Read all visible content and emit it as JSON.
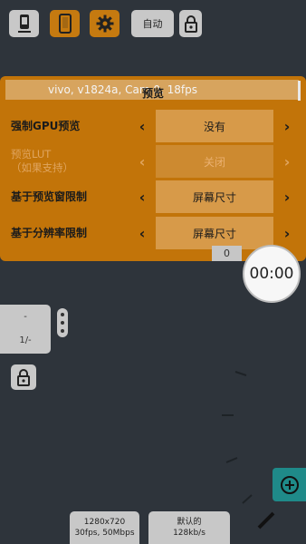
{
  "toolbar": {
    "auto_label": "自动",
    "icons": [
      "phone-preview-icon",
      "phone-icon",
      "gear-icon",
      "lock-icon"
    ]
  },
  "panel": {
    "title": "预览",
    "camera_info": "vivo, v1824a, Cam 0, 18fps",
    "rows": [
      {
        "label": "强制GPU预览",
        "value": "没有",
        "enabled": true
      },
      {
        "label": "预览LUT\n（如果支持）",
        "value": "关闭",
        "enabled": false
      },
      {
        "label": "基于预览窗限制",
        "value": "屏幕尺寸",
        "enabled": true
      },
      {
        "label": "基于分辨率限制",
        "value": "屏幕尺寸",
        "enabled": true
      }
    ],
    "arrow_left": "‹",
    "arrow_right": "›"
  },
  "zoom_value": "0",
  "timer": "00:00",
  "photo_card": {
    "dash": "-",
    "count": "1/-"
  },
  "bottom": {
    "resolution_line1": "1280x720",
    "resolution_line2": "30fps, 50Mbps",
    "bitrate_line1": "默认的",
    "bitrate_line2": "128kb/s"
  },
  "colors": {
    "background": "#2e343b",
    "panel": "#c27409",
    "accent_teal": "#1f8a89",
    "button_grey": "#c8c8c8",
    "button_orange": "#c57a10"
  }
}
